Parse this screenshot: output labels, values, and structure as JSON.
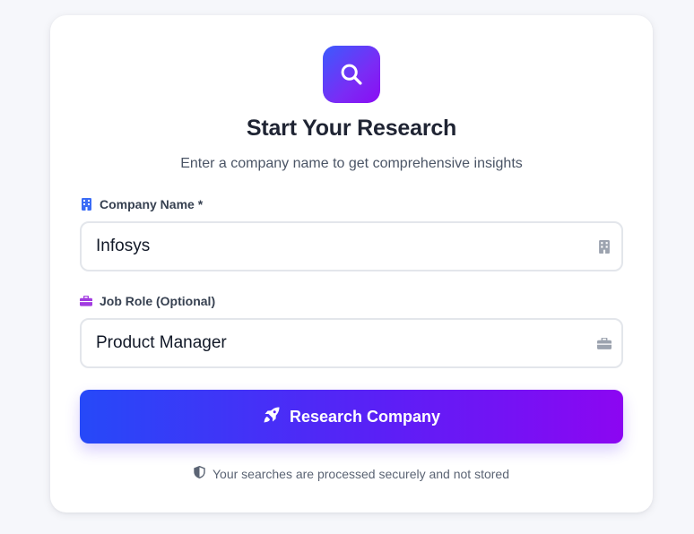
{
  "card": {
    "title": "Start Your Research",
    "subtitle": "Enter a company name to get comprehensive insights"
  },
  "form": {
    "company": {
      "label": "Company Name *",
      "value": "Infosys",
      "label_icon": "building-icon",
      "input_icon": "building-icon"
    },
    "role": {
      "label": "Job Role (Optional)",
      "value": "Product Manager",
      "label_icon": "briefcase-icon",
      "input_icon": "briefcase-icon"
    },
    "submit": {
      "label": "Research Company",
      "icon": "rocket-icon"
    }
  },
  "footer": {
    "note": "Your searches are processed securely and not stored",
    "icon": "shield-icon"
  },
  "colors": {
    "accent_start": "#2649f8",
    "accent_end": "#8c06f2",
    "company_label_icon": "#3b6cf6",
    "role_label_icon": "#a23ce0"
  }
}
